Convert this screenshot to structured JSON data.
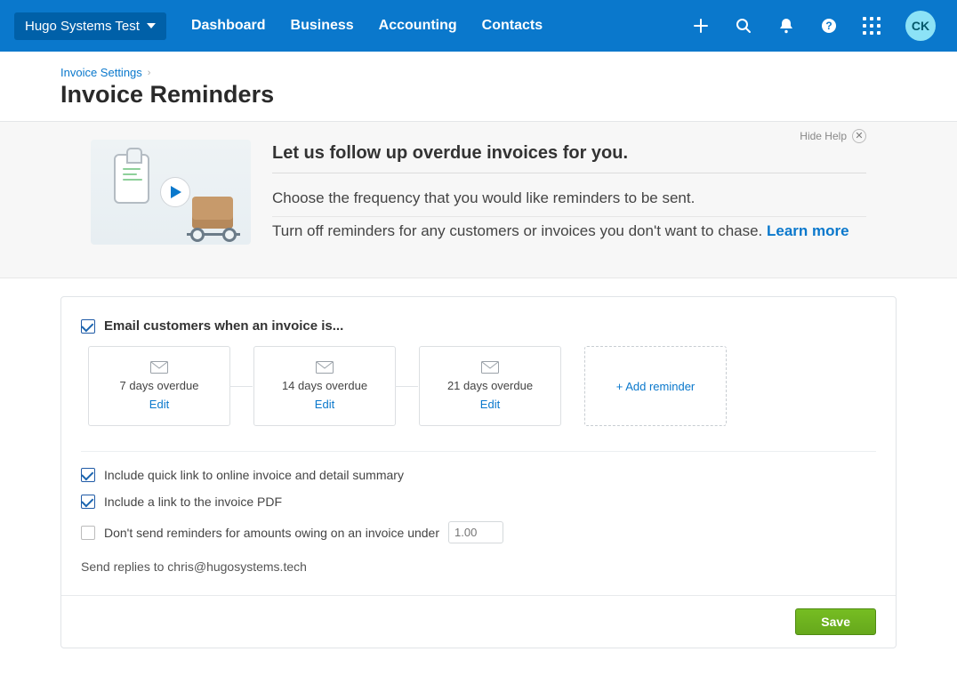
{
  "header": {
    "org_name": "Hugo Systems Test",
    "nav": [
      "Dashboard",
      "Business",
      "Accounting",
      "Contacts"
    ],
    "avatar_initials": "CK"
  },
  "breadcrumb": {
    "parent": "Invoice Settings"
  },
  "page_title": "Invoice Reminders",
  "help": {
    "hide_label": "Hide Help",
    "title": "Let us follow up overdue invoices for you.",
    "line1": "Choose the frequency that you would like reminders to be sent.",
    "line2_prefix": "Turn off reminders for any customers or invoices you don't want to chase. ",
    "learn_more": "Learn more"
  },
  "settings": {
    "email_when_label": "Email customers when an invoice is...",
    "reminders": [
      {
        "label": "7 days overdue",
        "edit": "Edit"
      },
      {
        "label": "14 days overdue",
        "edit": "Edit"
      },
      {
        "label": "21 days overdue",
        "edit": "Edit"
      }
    ],
    "add_reminder_label": "+ Add reminder",
    "opt_quicklink": "Include quick link to online invoice and detail summary",
    "opt_pdf": "Include a link to the invoice PDF",
    "opt_threshold": "Don't send reminders for amounts owing on an invoice under",
    "threshold_placeholder": "1.00",
    "replies_prefix": "Send replies to ",
    "replies_email": "chris@hugosystems.tech",
    "save_label": "Save"
  }
}
